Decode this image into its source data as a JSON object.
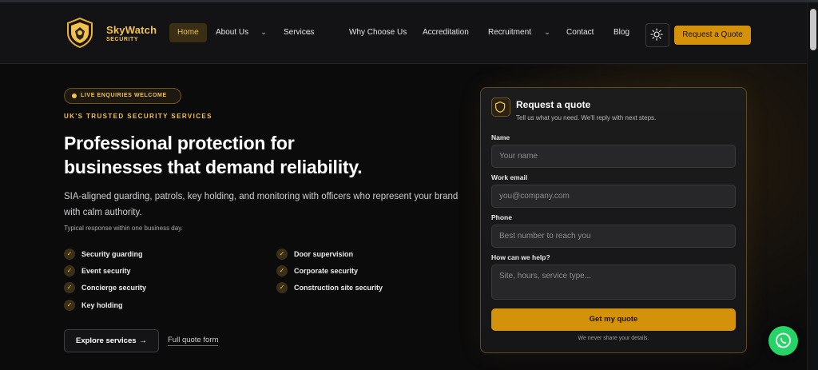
{
  "brand": {
    "name": "SkyWatch",
    "tagline": "SECURITY",
    "accent": "#f1c24d",
    "cta_color": "#d4920a"
  },
  "nav": {
    "items": [
      {
        "label": "Home",
        "active": true
      },
      {
        "label": "About Us",
        "dropdown": true
      },
      {
        "label": "Services",
        "dropdown": true
      },
      {
        "label": "Why Choose Us"
      },
      {
        "label": "Accreditation"
      },
      {
        "label": "Recruitment",
        "dropdown": true
      },
      {
        "label": "Contact"
      },
      {
        "label": "Blog"
      }
    ],
    "theme_toggle_icon": "sun-icon",
    "cta": "Request a Quote"
  },
  "hero": {
    "badge": "LIVE ENQUIRIES WELCOME",
    "kicker": "UK'S TRUSTED SECURITY SERVICES",
    "headline_line1": "Professional protection for",
    "headline_line2": "businesses that demand reliability.",
    "lede": "SIA-aligned guarding, patrols, key holding, and monitoring with officers who represent your brand with calm authority.",
    "fine_print": "Typical response within one business day.",
    "features": [
      "Security guarding",
      "Door supervision",
      "Event security",
      "Corporate security",
      "Concierge security",
      "Construction site security",
      "Key holding"
    ],
    "explore_button": "Explore services",
    "quote_link": "Full quote form"
  },
  "quote_form": {
    "title": "Request a quote",
    "subtitle": "Tell us what you need. We'll reply with next steps.",
    "fields": {
      "name": {
        "label": "Name",
        "placeholder": "Your name",
        "value": ""
      },
      "email": {
        "label": "Work email",
        "placeholder": "you@company.com",
        "value": ""
      },
      "phone": {
        "label": "Phone",
        "placeholder": "Best number to reach you",
        "value": ""
      },
      "help": {
        "label": "How can we help?",
        "placeholder": "Site, hours, service type...",
        "value": ""
      }
    },
    "submit": "Get my quote",
    "privacy": "We never share your details."
  },
  "chat_widget": {
    "icon": "whatsapp-icon",
    "color": "#25d366"
  }
}
